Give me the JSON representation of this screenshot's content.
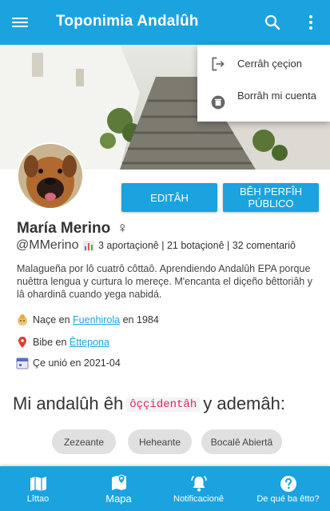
{
  "appbar": {
    "title": "Toponimia Andalûh",
    "menu_icon": "menu-icon",
    "search_icon": "search-icon",
    "more_icon": "more-vert-icon",
    "color": "#1aa3df"
  },
  "menu": {
    "items": [
      {
        "label": "Cerrâh çeçion",
        "icon": "logout-icon"
      },
      {
        "label": "Borrâh mi cuenta",
        "icon": "delete-icon"
      }
    ]
  },
  "profile": {
    "edit_label": "Editâh",
    "public_label": "Bêh perfîh público",
    "name": "María Merino",
    "gender_symbol": "♀",
    "handle": "@MMerino",
    "stats": "3 aportaçionê | 21 botaçionê | 32 comentariô",
    "bio": "Malagueña por lô cuatrô côttaô. Aprendiendo Andalûh EPA porque nuêttra lengua y curtura lo mereçe. M'encanta el diçeño bêttoriâh y lâ ohardinâ cuando yega nabidá.",
    "born": {
      "prefix": "Naçe en",
      "place": "Fuenhirola",
      "suffix": "en 1984"
    },
    "lives": {
      "prefix": "Bibe en",
      "place": "Êttepona"
    },
    "joined": "Çe unió en 2021-04",
    "dialect": {
      "before": "Mi andalûh êh",
      "code": "ôççidentâh",
      "after": "y ademâh:"
    },
    "tags": [
      "Zezeante",
      "Heheante",
      "Bocalê Abiertâ"
    ]
  },
  "bottom_nav": {
    "items": [
      {
        "label": "Lîttao",
        "icon": "map-book-icon"
      },
      {
        "label": "Mapa",
        "icon": "map-marker-icon"
      },
      {
        "label": "Notificacionê",
        "icon": "bell-icon"
      },
      {
        "label": "De qué ba êtto?",
        "icon": "help-icon"
      }
    ],
    "active": "Mapa"
  }
}
